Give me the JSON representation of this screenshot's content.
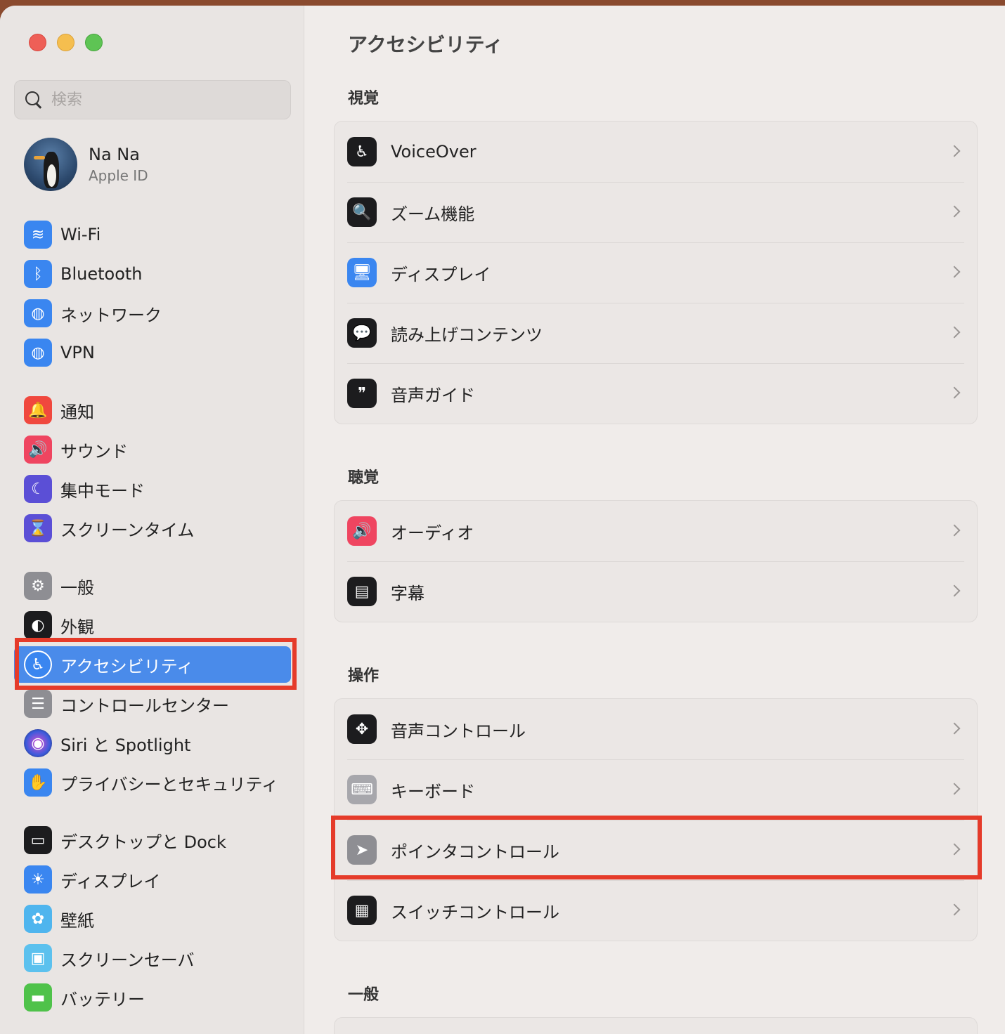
{
  "search": {
    "placeholder": "検索"
  },
  "profile": {
    "name": "Na Na",
    "subtitle": "Apple ID"
  },
  "sidebar": {
    "items": [
      {
        "label": "Wi-Fi",
        "icon": "wifi-icon",
        "glyph": "≋",
        "color": "#3a86f0"
      },
      {
        "label": "Bluetooth",
        "icon": "bluetooth-icon",
        "glyph": "ᛒ",
        "color": "#3a86f0"
      },
      {
        "label": "ネットワーク",
        "icon": "globe-icon",
        "glyph": "◍",
        "color": "#3a86f0"
      },
      {
        "label": "VPN",
        "icon": "vpn-globe-icon",
        "glyph": "◍",
        "color": "#3a86f0"
      },
      {
        "label": "通知",
        "icon": "bell-icon",
        "glyph": "🔔",
        "color": "#f0483e"
      },
      {
        "label": "サウンド",
        "icon": "speaker-icon",
        "glyph": "🔊",
        "color": "#ef4560"
      },
      {
        "label": "集中モード",
        "icon": "moon-icon",
        "glyph": "☾",
        "color": "#5b4fd6"
      },
      {
        "label": "スクリーンタイム",
        "icon": "hourglass-icon",
        "glyph": "⌛",
        "color": "#5b4fd6"
      },
      {
        "label": "一般",
        "icon": "gear-icon",
        "glyph": "⚙",
        "color": "#8e8e93"
      },
      {
        "label": "外観",
        "icon": "appearance-icon",
        "glyph": "◐",
        "color": "#1c1c1e"
      },
      {
        "label": "アクセシビリティ",
        "icon": "accessibility-icon",
        "glyph": "♿",
        "color": "#3a86f0"
      },
      {
        "label": "コントロールセンター",
        "icon": "toggles-icon",
        "glyph": "☰",
        "color": "#8e8e93"
      },
      {
        "label": "Siri と Spotlight",
        "icon": "siri-icon",
        "glyph": "◉",
        "color": "#6b3fb5"
      },
      {
        "label": "プライバシーとセキュリティ",
        "icon": "hand-icon",
        "glyph": "✋",
        "color": "#3a86f0"
      },
      {
        "label": "デスクトップと Dock",
        "icon": "dock-icon",
        "glyph": "▭",
        "color": "#1c1c1e"
      },
      {
        "label": "ディスプレイ",
        "icon": "brightness-icon",
        "glyph": "☀",
        "color": "#3a86f0"
      },
      {
        "label": "壁紙",
        "icon": "flower-icon",
        "glyph": "✿",
        "color": "#4fb5ee"
      },
      {
        "label": "スクリーンセーバ",
        "icon": "screensaver-icon",
        "glyph": "▣",
        "color": "#5cc1ee"
      },
      {
        "label": "バッテリー",
        "icon": "battery-icon",
        "glyph": "▬",
        "color": "#4fc24a"
      }
    ]
  },
  "main": {
    "title": "アクセシビリティ",
    "sections": [
      {
        "title": "視覚",
        "rows": [
          {
            "label": "VoiceOver",
            "icon": "voiceover-icon",
            "glyph": "♿",
            "color": "#1c1c1e"
          },
          {
            "label": "ズーム機能",
            "icon": "zoom-icon",
            "glyph": "🔍",
            "color": "#1c1c1e"
          },
          {
            "label": "ディスプレイ",
            "icon": "display-icon",
            "glyph": "🖥",
            "color": "#3a86f0"
          },
          {
            "label": "読み上げコンテンツ",
            "icon": "spoken-content-icon",
            "glyph": "💬",
            "color": "#1c1c1e"
          },
          {
            "label": "音声ガイド",
            "icon": "audio-descriptions-icon",
            "glyph": "❞",
            "color": "#1c1c1e"
          }
        ]
      },
      {
        "title": "聴覚",
        "rows": [
          {
            "label": "オーディオ",
            "icon": "audio-icon",
            "glyph": "🔊",
            "color": "#ef4560"
          },
          {
            "label": "字幕",
            "icon": "captions-icon",
            "glyph": "▤",
            "color": "#1c1c1e"
          }
        ]
      },
      {
        "title": "操作",
        "rows": [
          {
            "label": "音声コントロール",
            "icon": "voice-control-icon",
            "glyph": "✥",
            "color": "#1c1c1e"
          },
          {
            "label": "キーボード",
            "icon": "keyboard-icon",
            "glyph": "⌨",
            "color": "#a7a7ac"
          },
          {
            "label": "ポインタコントロール",
            "icon": "pointer-icon",
            "glyph": "➤",
            "color": "#8e8e93"
          },
          {
            "label": "スイッチコントロール",
            "icon": "switch-control-icon",
            "glyph": "▦",
            "color": "#1c1c1e"
          }
        ]
      },
      {
        "title": "一般",
        "rows": []
      }
    ]
  }
}
